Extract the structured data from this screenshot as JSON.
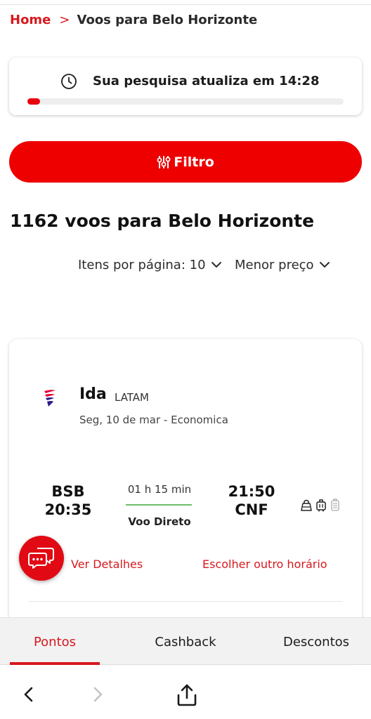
{
  "breadcrumb": {
    "home": "Home",
    "separator": ">",
    "current": "Voos para Belo Horizonte"
  },
  "refresh": {
    "text": "Sua pesquisa atualiza em 14:28",
    "icon": "clock-icon",
    "progress": 0.04
  },
  "filter": {
    "label": "Filtro",
    "icon": "sliders-icon"
  },
  "results": {
    "title": "1162 voos para Belo Horizonte"
  },
  "sort": {
    "per_page": "Itens por página: 10",
    "order": "Menor preço"
  },
  "flight": {
    "direction": "Ida",
    "airline": "LATAM",
    "date": "Seg, 10 de mar - Economica",
    "departure_code": "BSB",
    "departure_time": "20:35",
    "duration": "01 h 15 min",
    "type": "Voo Direto",
    "arrival_time": "21:50",
    "arrival_code": "CNF",
    "details_link": "Ver Detalhes",
    "other_time_link": "Escolher outro horário"
  },
  "tabs": [
    {
      "label": "Pontos",
      "active": true
    },
    {
      "label": "Cashback",
      "active": false
    },
    {
      "label": "Descontos",
      "active": false
    }
  ],
  "colors": {
    "brand_red": "#d7191f",
    "button_red": "#ee0000",
    "direct_line": "#6cbf6c"
  }
}
